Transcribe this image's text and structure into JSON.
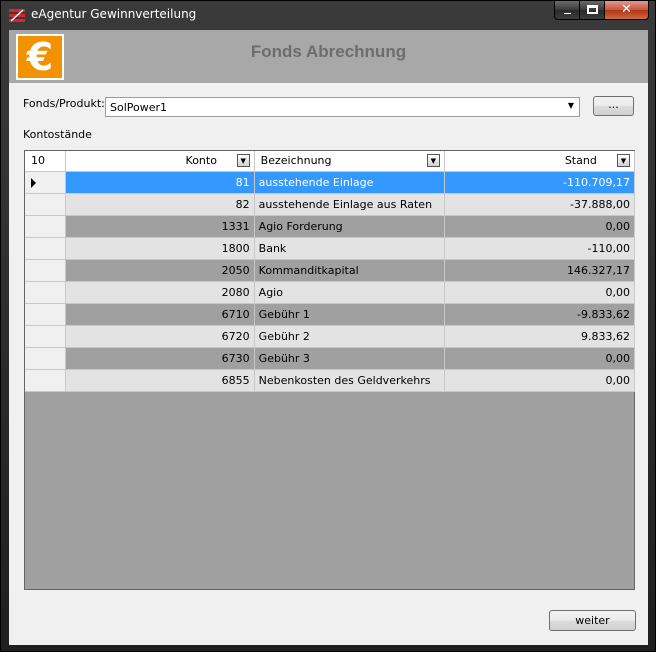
{
  "window": {
    "title": "eAgentur Gewinnverteilung",
    "icon": "app-logo-icon",
    "close_glyph": "✕"
  },
  "header": {
    "logo_symbol": "€",
    "title": "Fonds Abrechnung"
  },
  "form": {
    "fonds_label": "Fonds/Produkt:",
    "fonds_value": "SolPower1",
    "combo_arrow": "▼",
    "browse_label": "..."
  },
  "grid": {
    "section_label": "Kontostände",
    "row_count": "10",
    "columns": [
      "Konto",
      "Bezeichnung",
      "Stand"
    ],
    "filter_glyph": "▼",
    "rows": [
      {
        "konto": "81",
        "bezeichnung": "ausstehende Einlage",
        "stand": "-110.709,17",
        "selected": true
      },
      {
        "konto": "82",
        "bezeichnung": "ausstehende Einlage aus Raten",
        "stand": "-37.888,00"
      },
      {
        "konto": "1331",
        "bezeichnung": "Agio Forderung",
        "stand": "0,00"
      },
      {
        "konto": "1800",
        "bezeichnung": "Bank",
        "stand": "-110,00"
      },
      {
        "konto": "2050",
        "bezeichnung": "Kommanditkapital",
        "stand": "146.327,17"
      },
      {
        "konto": "2080",
        "bezeichnung": "Agio",
        "stand": "0,00"
      },
      {
        "konto": "6710",
        "bezeichnung": "Gebühr 1",
        "stand": "-9.833,62"
      },
      {
        "konto": "6720",
        "bezeichnung": "Gebühr 2",
        "stand": "9.833,62"
      },
      {
        "konto": "6730",
        "bezeichnung": "Gebühr 3",
        "stand": "0,00"
      },
      {
        "konto": "6855",
        "bezeichnung": "Nebenkosten des Geldverkehrs",
        "stand": "0,00"
      }
    ]
  },
  "footer": {
    "next_label": "weiter"
  },
  "colors": {
    "selection": "#3399ff",
    "logo": "#f39200",
    "header_band": "#a8a8a8"
  }
}
